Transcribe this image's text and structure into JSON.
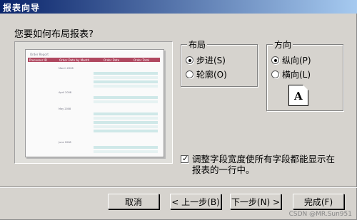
{
  "window": {
    "title": "报表向导"
  },
  "question": "您要如何布局报表?",
  "preview": {
    "report_title": "Order Report",
    "columns": [
      "Processor ID",
      "Order Date by Month",
      "Order Date",
      "Order Total"
    ],
    "groups": [
      "March 2008",
      "April 2008",
      "May 2008",
      "June 2008"
    ]
  },
  "layout": {
    "label": "布局",
    "options": [
      {
        "label": "步进(S)",
        "checked": true
      },
      {
        "label": "轮廓(O)",
        "checked": false
      }
    ]
  },
  "orientation": {
    "label": "方向",
    "options": [
      {
        "label": "纵向(P)",
        "checked": true
      },
      {
        "label": "横向(L)",
        "checked": false
      }
    ],
    "icon_letter": "A"
  },
  "adjust_width": {
    "label": "调整字段宽度使所有字段都能显示在报表的一行中。",
    "checked": true
  },
  "buttons": {
    "cancel": "取消",
    "back": "< 上一步(B)",
    "next": "下一步(N) >",
    "finish": "完成(F)"
  },
  "watermark": "CSDN @MR.Sun951"
}
